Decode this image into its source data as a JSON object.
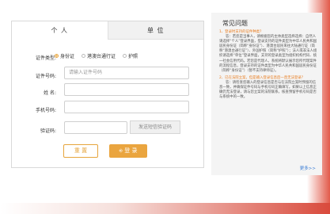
{
  "login": {
    "tabs": [
      {
        "label": "个 人",
        "active": true
      },
      {
        "label": "单 位",
        "active": false
      }
    ],
    "cert_type_label": "证件类型:",
    "cert_types": [
      {
        "label": "身份证",
        "selected": true
      },
      {
        "label": "港澳台通行证",
        "selected": false
      },
      {
        "label": "护照",
        "selected": false
      }
    ],
    "cert_no_label": "证件号码:",
    "cert_no_placeholder": "请输入证件号码",
    "name_label": "姓 名:",
    "phone_label": "手机号码:",
    "code_label": "验证码:",
    "send_code": "发送短信验证码",
    "reset": "重 置",
    "login": "登 录"
  },
  "faq": {
    "title": "常见问题",
    "items": [
      {
        "q": "1、登录时支持的证件种类？",
        "a": "答：若您是当事人，请根据您的主体类型选择选择：自然人请选择“个人”登录界面，登录支持的证件类型为中华人民共和国居民身份证（简称“身份证”）、港澳台居民来往大陆通行证（简称“港澳台通行证”）、外国护照（简称“护照”）；法人或非法人组织请选择“单位”登录界面，支持的登录类型为组织机构代码、统一社会信用代码。若您是代理人，系统将默认展示您所代理案件的流程信息，登录支持的证件类型为中华人民共和国居民身份证（简称“身份证”）（暂不支持律师证）。"
      },
      {
        "q": "2、已在法院立案，但是输入登录信息后一直无法登录？",
        "a": "答：请检查您输入的登录信息是否与在法院立案时预留的信息一致，并确保证件号码与手机号码正确填写。如果以上信息正确仍无法登录，请与您立案的法院联系，核查预留手机号码是否与系统中的一致。"
      }
    ],
    "more": "更多>>"
  }
}
